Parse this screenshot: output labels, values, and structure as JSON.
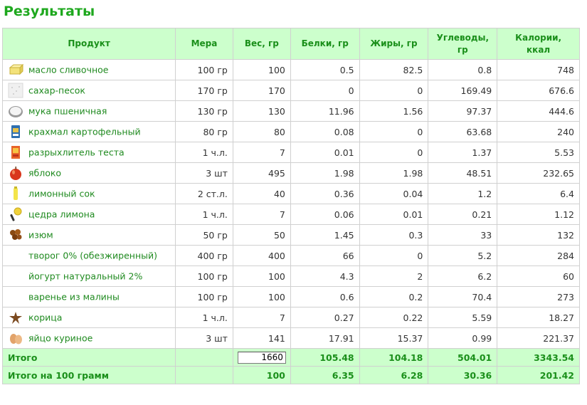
{
  "title": "Результаты",
  "headers": {
    "product": "Продукт",
    "measure": "Мера",
    "weight": "Вес, гр",
    "protein": "Белки, гр",
    "fat": "Жиры, гр",
    "carbs_line1": "Углеводы,",
    "carbs_line2": "гр",
    "kcal_line1": "Калории,",
    "kcal_line2": "ккал"
  },
  "rows": [
    {
      "name": "масло сливочное",
      "measure": "100 гр",
      "weight": "100",
      "protein": "0.5",
      "fat": "82.5",
      "carbs": "0.8",
      "kcal": "748",
      "icon": "butter-icon"
    },
    {
      "name": "сахар-песок",
      "measure": "170 гр",
      "weight": "170",
      "protein": "0",
      "fat": "0",
      "carbs": "169.49",
      "kcal": "676.6",
      "icon": "sugar-icon"
    },
    {
      "name": "мука пшеничная",
      "measure": "130 гр",
      "weight": "130",
      "protein": "11.96",
      "fat": "1.56",
      "carbs": "97.37",
      "kcal": "444.6",
      "icon": "flour-icon"
    },
    {
      "name": "крахмал картофельный",
      "measure": "80 гр",
      "weight": "80",
      "protein": "0.08",
      "fat": "0",
      "carbs": "63.68",
      "kcal": "240",
      "icon": "starch-icon"
    },
    {
      "name": "разрыхлитель теста",
      "measure": "1 ч.л.",
      "weight": "7",
      "protein": "0.01",
      "fat": "0",
      "carbs": "1.37",
      "kcal": "5.53",
      "icon": "baking-powder-icon"
    },
    {
      "name": "яблоко",
      "measure": "3 шт",
      "weight": "495",
      "protein": "1.98",
      "fat": "1.98",
      "carbs": "48.51",
      "kcal": "232.65",
      "icon": "apple-icon"
    },
    {
      "name": "лимонный сок",
      "measure": "2 ст.л.",
      "weight": "40",
      "protein": "0.36",
      "fat": "0.04",
      "carbs": "1.2",
      "kcal": "6.4",
      "icon": "lemon-juice-icon"
    },
    {
      "name": "цедра лимона",
      "measure": "1 ч.л.",
      "weight": "7",
      "protein": "0.06",
      "fat": "0.01",
      "carbs": "0.21",
      "kcal": "1.12",
      "icon": "zester-icon"
    },
    {
      "name": "изюм",
      "measure": "50 гр",
      "weight": "50",
      "protein": "1.45",
      "fat": "0.3",
      "carbs": "33",
      "kcal": "132",
      "icon": "raisins-icon"
    },
    {
      "name": "творог 0% (обезжиренный)",
      "measure": "400 гр",
      "weight": "400",
      "protein": "66",
      "fat": "0",
      "carbs": "5.2",
      "kcal": "284",
      "icon": ""
    },
    {
      "name": "йогурт натуральный 2%",
      "measure": "100 гр",
      "weight": "100",
      "protein": "4.3",
      "fat": "2",
      "carbs": "6.2",
      "kcal": "60",
      "icon": ""
    },
    {
      "name": "варенье из малины",
      "measure": "100 гр",
      "weight": "100",
      "protein": "0.6",
      "fat": "0.2",
      "carbs": "70.4",
      "kcal": "273",
      "icon": ""
    },
    {
      "name": "корица",
      "measure": "1 ч.л.",
      "weight": "7",
      "protein": "0.27",
      "fat": "0.22",
      "carbs": "5.59",
      "kcal": "18.27",
      "icon": "cinnamon-icon"
    },
    {
      "name": "яйцо куриное",
      "measure": "3 шт",
      "weight": "141",
      "protein": "17.91",
      "fat": "15.37",
      "carbs": "0.99",
      "kcal": "221.37",
      "icon": "eggs-icon"
    }
  ],
  "total": {
    "label": "Итого",
    "weight_input": "1660",
    "protein": "105.48",
    "fat": "104.18",
    "carbs": "504.01",
    "kcal": "3343.54"
  },
  "per100": {
    "label": "Итого на 100 грамм",
    "weight": "100",
    "protein": "6.35",
    "fat": "6.28",
    "carbs": "30.36",
    "kcal": "201.42"
  },
  "colors": {
    "accent_green": "#1ea81e",
    "header_bg": "#ccffcc",
    "border": "#d0d0d0"
  }
}
